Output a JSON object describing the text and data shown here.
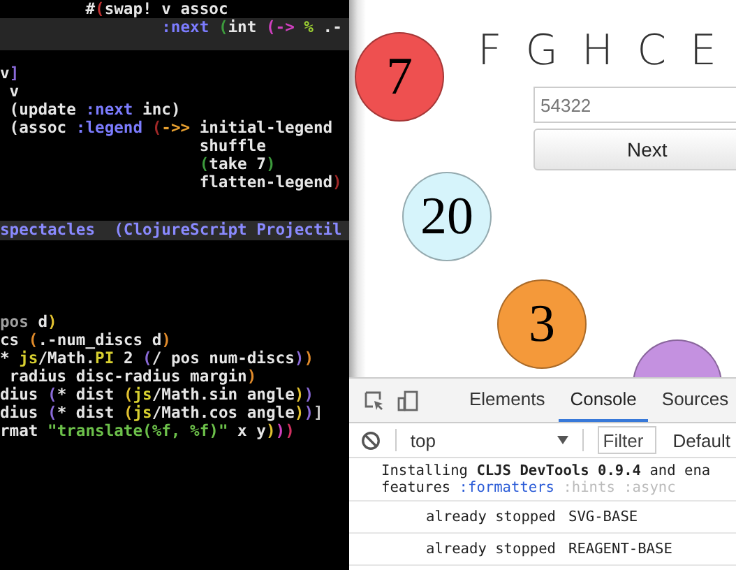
{
  "editor": {
    "top_lines": [
      {
        "current": false,
        "tokens": [
          {
            "text": "         #",
            "color": "#e6e6e6"
          },
          {
            "text": "(",
            "color": "#c03030"
          },
          {
            "text": "swap! v assoc",
            "color": "#e6e6e6"
          }
        ]
      },
      {
        "current": true,
        "tokens": [
          {
            "text": "                 :next",
            "color": "#7c7cff"
          },
          {
            "text": " (",
            "color": "#3c9a3c"
          },
          {
            "text": "int ",
            "color": "#e6e6e6"
          },
          {
            "text": "(->",
            "color": "#d040c0"
          },
          {
            "text": " %",
            "color": "#9acd32"
          },
          {
            "text": " .-",
            "color": "#e6e6e6"
          }
        ]
      }
    ],
    "middle_lines": [
      {
        "current": false,
        "tokens": [
          {
            "text": "v",
            "color": "#e6e6e6"
          },
          {
            "text": "]",
            "color": "#8a6ad8"
          }
        ]
      },
      {
        "current": false,
        "tokens": [
          {
            "text": " v",
            "color": "#e6e6e6"
          }
        ]
      },
      {
        "current": false,
        "tokens": [
          {
            "text": " (update ",
            "color": "#e6e6e6"
          },
          {
            "text": ":next",
            "color": "#7c7cff"
          },
          {
            "text": " inc)",
            "color": "#e6e6e6"
          }
        ]
      },
      {
        "current": false,
        "tokens": [
          {
            "text": " (assoc ",
            "color": "#e6e6e6"
          },
          {
            "text": ":legend",
            "color": "#7c7cff"
          },
          {
            "text": " (",
            "color": "#a02828"
          },
          {
            "text": "->>",
            "color": "#e8a030"
          },
          {
            "text": " initial-legend",
            "color": "#e6e6e6"
          }
        ]
      },
      {
        "current": false,
        "tokens": [
          {
            "text": "                     shuffle",
            "color": "#e6e6e6"
          }
        ]
      },
      {
        "current": false,
        "tokens": [
          {
            "text": "                     (",
            "color": "#3c9a3c"
          },
          {
            "text": "take 7",
            "color": "#e6e6e6"
          },
          {
            "text": ")",
            "color": "#3c9a3c"
          }
        ]
      },
      {
        "current": false,
        "tokens": [
          {
            "text": "                     flatten-legend",
            "color": "#e6e6e6"
          },
          {
            "text": ")",
            "color": "#a02828"
          }
        ]
      }
    ],
    "modeline": "spectacles  (ClojureScript Projectil",
    "bottom_lines": [
      {
        "current": false,
        "tokens": [
          {
            "text": "pos",
            "color": "#a0a0a0"
          },
          {
            "text": " d",
            "color": "#e6e6e6"
          },
          {
            "text": ")",
            "color": "#e0c030"
          }
        ]
      },
      {
        "current": false,
        "tokens": [
          {
            "text": "cs ",
            "color": "#e6e6e6"
          },
          {
            "text": "(",
            "color": "#e08a2a"
          },
          {
            "text": ".-num_discs d",
            "color": "#e6e6e6"
          },
          {
            "text": ")",
            "color": "#e08a2a"
          }
        ]
      },
      {
        "current": false,
        "tokens": [
          {
            "text": "* ",
            "color": "#e6e6e6"
          },
          {
            "text": "js",
            "color": "#d8d030"
          },
          {
            "text": "/Math.",
            "color": "#e6e6e6"
          },
          {
            "text": "PI",
            "color": "#d8d030"
          },
          {
            "text": " 2 ",
            "color": "#e6e6e6"
          },
          {
            "text": "(",
            "color": "#8a6ad8"
          },
          {
            "text": "/ pos num-discs",
            "color": "#e6e6e6"
          },
          {
            "text": ")",
            "color": "#8a6ad8"
          },
          {
            "text": ")",
            "color": "#e08a2a"
          }
        ]
      },
      {
        "current": false,
        "tokens": [
          {
            "text": " radius disc-radius margin",
            "color": "#e6e6e6"
          },
          {
            "text": ")",
            "color": "#e08a2a"
          }
        ]
      },
      {
        "current": false,
        "tokens": [
          {
            "text": "dius ",
            "color": "#e6e6e6"
          },
          {
            "text": "(",
            "color": "#8a6ad8"
          },
          {
            "text": "* dist ",
            "color": "#e6e6e6"
          },
          {
            "text": "(",
            "color": "#e0c030"
          },
          {
            "text": "js",
            "color": "#d8d030"
          },
          {
            "text": "/Math.sin angle",
            "color": "#e6e6e6"
          },
          {
            "text": ")",
            "color": "#e0c030"
          },
          {
            "text": ")",
            "color": "#8a6ad8"
          }
        ]
      },
      {
        "current": false,
        "tokens": [
          {
            "text": "dius ",
            "color": "#e6e6e6"
          },
          {
            "text": "(",
            "color": "#8a6ad8"
          },
          {
            "text": "* dist ",
            "color": "#e6e6e6"
          },
          {
            "text": "(",
            "color": "#e0c030"
          },
          {
            "text": "js",
            "color": "#d8d030"
          },
          {
            "text": "/Math.cos angle",
            "color": "#e6e6e6"
          },
          {
            "text": ")",
            "color": "#e0c030"
          },
          {
            "text": ")",
            "color": "#8a6ad8"
          },
          {
            "text": "]",
            "color": "#c8c8c8"
          }
        ]
      },
      {
        "current": false,
        "tokens": [
          {
            "text": "rmat ",
            "color": "#e6e6e6"
          },
          {
            "text": "\"translate(%f, %f)\"",
            "color": "#6cc04a"
          },
          {
            "text": " x y",
            "color": "#e6e6e6"
          },
          {
            "text": ")",
            "color": "#e0c030"
          },
          {
            "text": ")",
            "color": "#d040c0"
          },
          {
            "text": ")",
            "color": "#d03060"
          }
        ]
      }
    ]
  },
  "page": {
    "discs": [
      {
        "number": "7",
        "color": "#ee5050"
      },
      {
        "number": "20",
        "color": "#d6f4fb"
      },
      {
        "number": "3",
        "color": "#f4993a"
      },
      {
        "color": "#c491e0"
      }
    ],
    "legend": [
      "F",
      "G",
      "H",
      "C",
      "E"
    ],
    "answer_field": {
      "placeholder": "54322"
    },
    "next_button": "Next"
  },
  "devtools": {
    "tabs": [
      {
        "label": "Elements",
        "selected": false
      },
      {
        "label": "Console",
        "selected": true
      },
      {
        "label": "Sources",
        "selected": false
      }
    ],
    "context": "top",
    "filter": {
      "placeholder": "Filter"
    },
    "levels": "Default",
    "messages": [
      {
        "kind": "rich",
        "lines": [
          [
            {
              "text": "Installing ",
              "kind": "plain"
            },
            {
              "text": "CLJS DevTools 0.9.4",
              "kind": "bold"
            },
            {
              "text": " and ena",
              "kind": "plain"
            }
          ],
          [
            {
              "text": "features ",
              "kind": "plain"
            },
            {
              "text": ":formatters",
              "kind": "keyword"
            },
            {
              "text": " :hints :async",
              "kind": "dim"
            }
          ]
        ]
      },
      {
        "kind": "pair",
        "label": "already stopped",
        "value": "SVG-BASE"
      },
      {
        "kind": "pair",
        "label": "already stopped",
        "value": "REAGENT-BASE"
      }
    ]
  }
}
